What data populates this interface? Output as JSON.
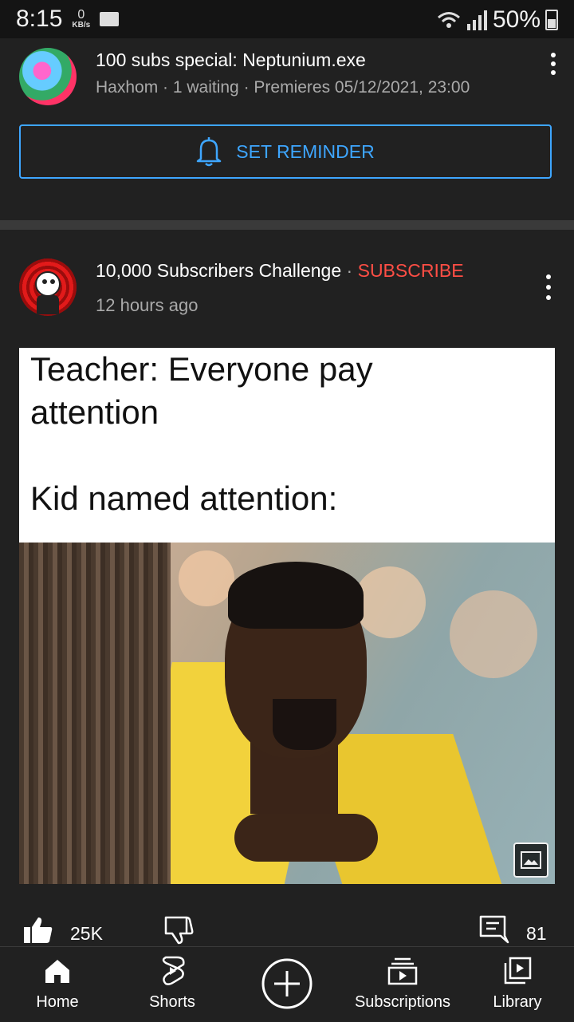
{
  "status_bar": {
    "time": "8:15",
    "net_speed_value": "0",
    "net_speed_unit": "KB/s",
    "battery": "50%"
  },
  "premiere_post": {
    "title": "100 subs special: Neptunium.exe",
    "meta": "Haxhom · 1 waiting · Premieres 05/12/2021, 23:00",
    "reminder_label": "SET REMINDER"
  },
  "community_post": {
    "channel": "10,000 Subscribers Challenge",
    "separator": "·",
    "subscribe_label": "SUBSCRIBE",
    "time": "12 hours ago",
    "meme": {
      "line1": "Teacher: Everyone pay",
      "line2": "attention",
      "line3": "Kid named attention:"
    },
    "likes": "25K",
    "comments": "81"
  },
  "nav": {
    "home": "Home",
    "shorts": "Shorts",
    "subscriptions": "Subscriptions",
    "library": "Library"
  },
  "colors": {
    "background": "#212121",
    "accent_blue": "#3ea6ff",
    "subscribe_red": "#ff4e45",
    "secondary_text": "#aaaaaa"
  }
}
